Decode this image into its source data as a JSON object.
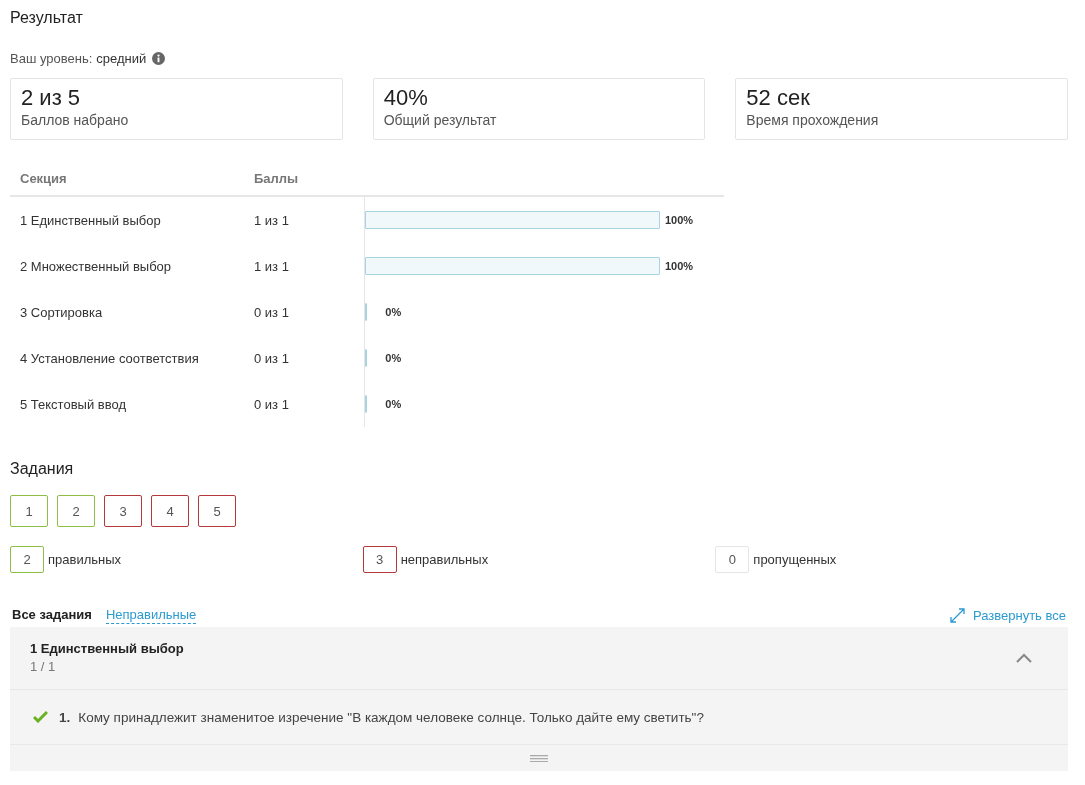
{
  "title": "Результат",
  "level": {
    "label": "Ваш уровень:",
    "value": "средний"
  },
  "stats": [
    {
      "value": "2 из 5",
      "label": "Баллов набрано"
    },
    {
      "value": "40%",
      "label": "Общий результат"
    },
    {
      "value": "52 сек",
      "label": "Время прохождения"
    }
  ],
  "table": {
    "columns": [
      "Секция",
      "Баллы"
    ],
    "rows": [
      {
        "section": "1 Единственный выбор",
        "score": "1 из 1",
        "level": 1,
        "percent": "100%"
      },
      {
        "section": "2 Множественный выбор",
        "score": "1 из 1",
        "level": 1,
        "percent": "100%"
      },
      {
        "section": "3 Сортировка",
        "score": "0 из 1",
        "level": 0,
        "percent": "0%"
      },
      {
        "section": "4 Установление соответствия",
        "score": "0 из 1",
        "level": 0,
        "percent": "0%"
      },
      {
        "section": "5 Текстовый ввод",
        "score": "0 из 1",
        "level": 0,
        "percent": "0%"
      }
    ]
  },
  "tasks_title": "Задания",
  "tasks": [
    {
      "label": "1",
      "color": "#8dbf46"
    },
    {
      "label": "2",
      "color": "#8dbf46"
    },
    {
      "label": "3",
      "color": "#b5393a"
    },
    {
      "label": "4",
      "color": "#b5393a"
    },
    {
      "label": "5",
      "color": "#b5393a"
    }
  ],
  "summary": [
    {
      "count": "2",
      "label": "правильных",
      "color": "#8dbf46"
    },
    {
      "count": "3",
      "label": "неправильных",
      "color": "#b5393a"
    },
    {
      "count": "0",
      "label": "пропущенных",
      "color": "#e6e6e6"
    }
  ],
  "filters": [
    {
      "label": "Все задания",
      "selected": true
    },
    {
      "label": "Неправильные",
      "selected": false
    }
  ],
  "expand_all": "Развернуть все",
  "section": {
    "title": "1 Единственный выбор",
    "score": "1 / 1",
    "expanded": true,
    "questions": [
      {
        "number": "1.",
        "text": "Кому принадлежит знаменитое изречение \"В каждом человеке солнце. Только дайте ему светить\"?",
        "correct": true
      }
    ]
  }
}
